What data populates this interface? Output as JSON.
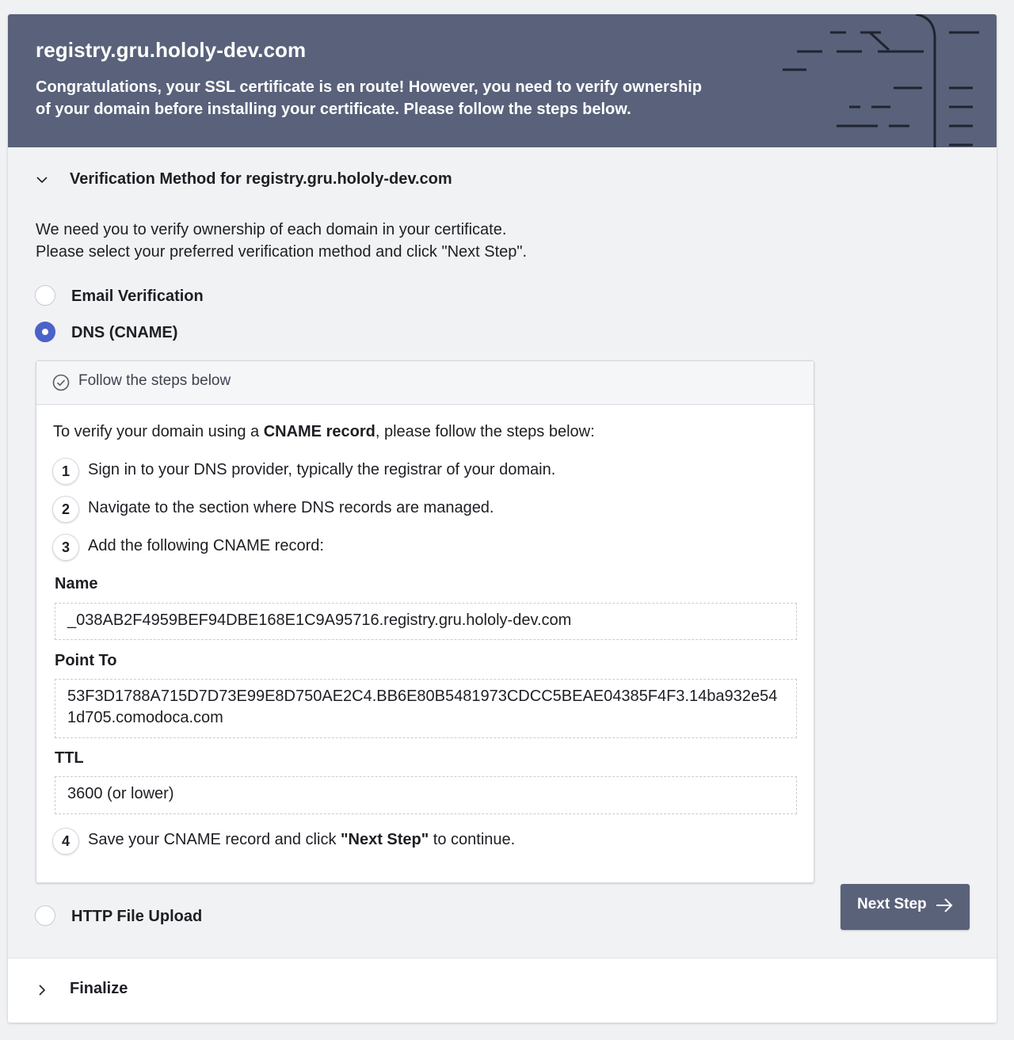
{
  "banner": {
    "domain": "registry.gru.hololy-dev.com",
    "message": "Congratulations, your SSL certificate is en route! However, you need to verify ownership of your domain before installing your certificate. Please follow the steps below."
  },
  "verification": {
    "title": "Verification Method for registry.gru.hololy-dev.com",
    "intro_line1": "We need you to verify ownership of each domain in your certificate.",
    "intro_line2": "Please select your preferred verification method and click \"Next Step\".",
    "options": {
      "email": "Email Verification",
      "dns": "DNS (CNAME)",
      "http": "HTTP File Upload"
    },
    "selected": "DNS (CNAME)"
  },
  "panel": {
    "header": "Follow the steps below",
    "intro_prefix": "To verify your domain using a ",
    "intro_bold": "CNAME record",
    "intro_suffix": ", please follow the steps below:",
    "steps": [
      {
        "num": "1",
        "text": "Sign in to your DNS provider, typically the registrar of your domain."
      },
      {
        "num": "2",
        "text": "Navigate to the section where DNS records are managed."
      },
      {
        "num": "3",
        "text": "Add the following CNAME record:"
      },
      {
        "num": "4",
        "prefix": "Save your CNAME record and click ",
        "bold": "\"Next Step\"",
        "suffix": " to continue."
      }
    ],
    "fields": {
      "name_label": "Name",
      "name_value": "_038AB2F4959BEF94DBE168E1C9A95716.registry.gru.hololy-dev.com",
      "point_label": "Point To",
      "point_value": "53F3D1788A715D7D73E99E8D750AE2C4.BB6E80B5481973CDCC5BEAE04385F4F3.14ba932e541d705.comodoca.com",
      "ttl_label": "TTL",
      "ttl_value": "3600 (or lower)"
    }
  },
  "next_button": "Next Step",
  "finalize": "Finalize",
  "icons": {
    "collapse": "chevron-down-icon",
    "expand": "chevron-right-icon",
    "check": "check-circle-icon",
    "arrow": "arrow-right-icon"
  },
  "colors": {
    "banner": "#59627a",
    "accent": "#4b62c9",
    "button": "#5a627a"
  }
}
